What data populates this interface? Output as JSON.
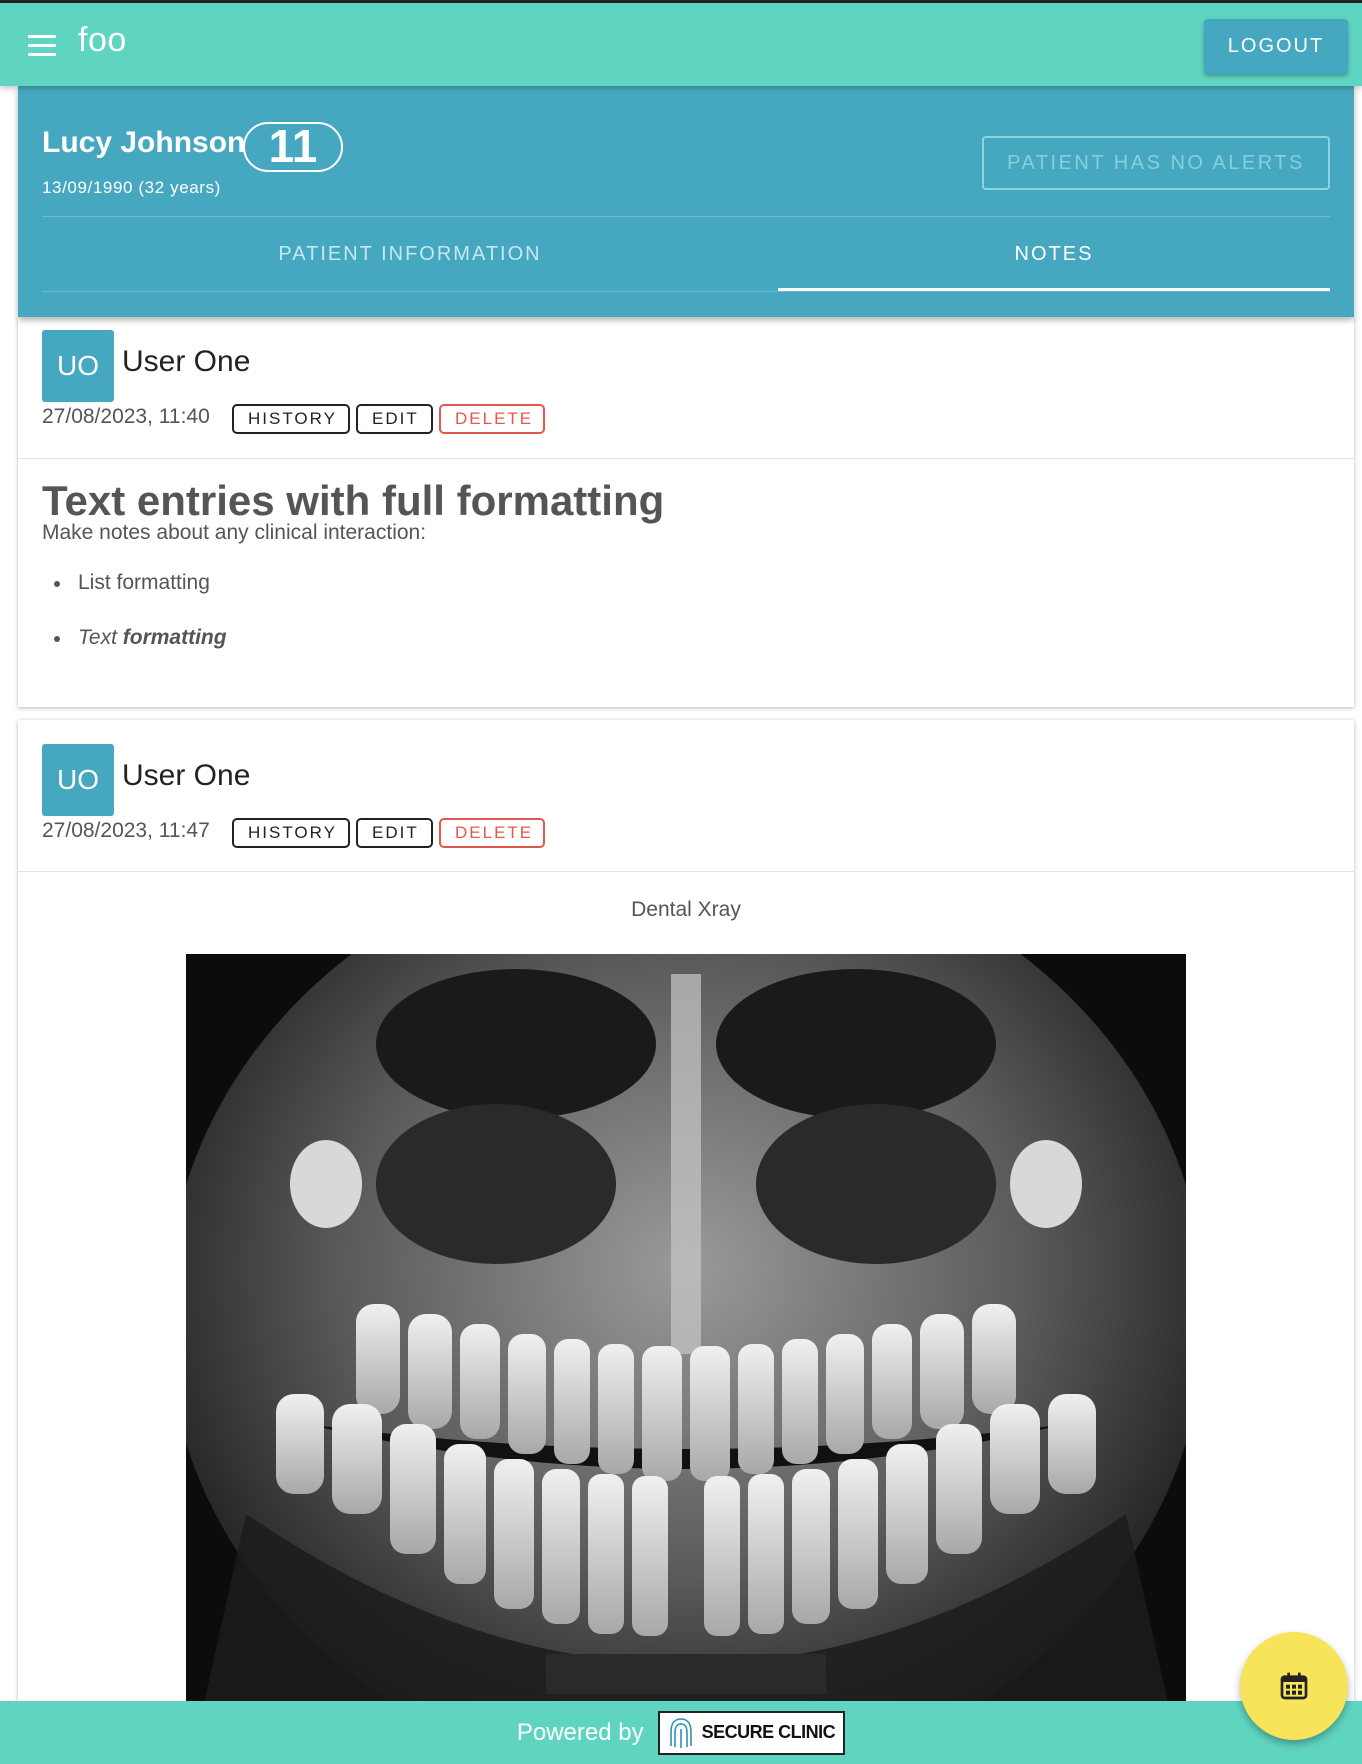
{
  "app": {
    "title": "foo",
    "logout_label": "LOGOUT"
  },
  "patient": {
    "name": "Lucy Johnson",
    "number": "11",
    "dob": "13/09/1990 (32 years)",
    "alerts_label": "PATIENT HAS NO ALERTS"
  },
  "tabs": [
    {
      "label": "PATIENT INFORMATION",
      "active": false
    },
    {
      "label": "NOTES",
      "active": true
    }
  ],
  "notes": [
    {
      "initials": "UO",
      "author": "User One",
      "timestamp": "27/08/2023, 11:40",
      "actions": {
        "history": "HISTORY",
        "edit": "EDIT",
        "delete": "DELETE"
      },
      "heading": "Text entries with full formatting",
      "intro": "Make notes about any clinical interaction:",
      "list": [
        "List formatting"
      ],
      "styled_item": {
        "italic": "Text",
        "bold_italic": "formatting"
      }
    },
    {
      "initials": "UO",
      "author": "User One",
      "timestamp": "27/08/2023, 11:47",
      "actions": {
        "history": "HISTORY",
        "edit": "EDIT",
        "delete": "DELETE"
      },
      "caption": "Dental Xray",
      "image": "dental-xray-panoramic"
    }
  ],
  "footer": {
    "powered_by": "Powered by",
    "brand": "SECURE CLINIC"
  },
  "fab": {
    "icon": "calendar-icon"
  },
  "colors": {
    "topbar": "#5fd5c1",
    "header": "#46a8c0",
    "delete": "#e0584f",
    "fab": "#f8e45a"
  }
}
